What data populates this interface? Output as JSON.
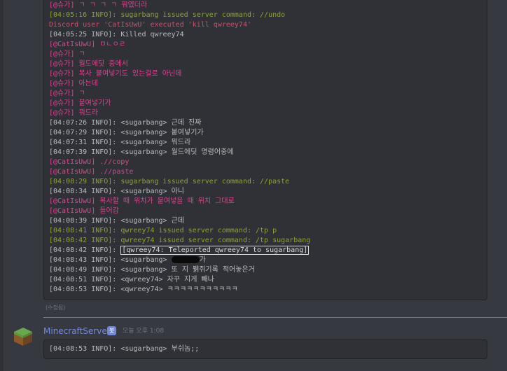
{
  "message1": {
    "lines": [
      {
        "text": "[@슈가] ㄱ ㄱ ㄱ ㄱ 뭐였더라",
        "color": "magenta"
      },
      {
        "text": "[04:05:16 INFO]: sugarbang issued server command: //undo",
        "color": "green"
      },
      {
        "text": "Discord user 'CatIsUwU' executed 'kill qwreey74'",
        "color": "pink"
      },
      {
        "text": "[04:05:25 INFO]: Killed qwreey74",
        "color": "plain"
      },
      {
        "text": "[@CatIsUwU] ㅁㄴㅇㄹ",
        "color": "magenta"
      },
      {
        "text": "[@슈가] ㄱ",
        "color": "magenta"
      },
      {
        "text": "[@슈가] 월드에딧 중에서",
        "color": "magenta"
      },
      {
        "text": "[@슈가] 복사 붙여넣기도 있는걸로 아닌데",
        "color": "magenta"
      },
      {
        "text": "[@슈가] 아는데",
        "color": "magenta"
      },
      {
        "text": "[@슈가] ㄱ",
        "color": "magenta"
      },
      {
        "text": "[@슈가] 붙여넣기가",
        "color": "magenta"
      },
      {
        "text": "[@슈가] 뭐드라",
        "color": "magenta"
      },
      {
        "text": "[04:07:26 INFO]: <sugarbang> 근데 진짜",
        "color": "plain"
      },
      {
        "text": "[04:07:29 INFO]: <sugarbang> 붙여넣기가",
        "color": "plain"
      },
      {
        "text": "[04:07:31 INFO]: <sugarbang> 뭐드라",
        "color": "plain"
      },
      {
        "text": "[04:07:39 INFO]: <sugarbang> 월드에딧 명령어중에",
        "color": "plain"
      },
      {
        "text": "[@CatIsUwU] .//copy",
        "color": "magenta"
      },
      {
        "text": "[@CatIsUwU] .//paste",
        "color": "magenta"
      },
      {
        "text": "[04:08:29 INFO]: sugarbang issued server command: //paste",
        "color": "green"
      },
      {
        "text": "[04:08:34 INFO]: <sugarbang> 아니",
        "color": "plain"
      },
      {
        "text": "[@CatIsUwU] 복사할 때 위치가 붙여넣을 때 위치 그대로",
        "color": "magenta"
      },
      {
        "text": "[@CatIsUwU] 들어감",
        "color": "magenta"
      },
      {
        "text": "[04:08:39 INFO]: <sugarbang> 근데",
        "color": "plain"
      },
      {
        "text": "[04:08:41 INFO]: qwreey74 issued server command: /tp p",
        "color": "green"
      },
      {
        "text": "[04:08:42 INFO]: qwreey74 issued server command: /tp sugarbang",
        "color": "green"
      },
      {
        "text": "[04:08:42 INFO]: ",
        "color": "plain",
        "highlight": "[qwreey74: Teleported qwreey74 to sugarbang]"
      },
      {
        "text": "[04:08:43 INFO]: <sugarbang> ",
        "color": "plain",
        "censored": true,
        "suffix": "가"
      },
      {
        "text": "[04:08:49 INFO]: <sugarbang> 또 지 뷁쥐기록 적어놓은거",
        "color": "plain"
      },
      {
        "text": "[04:08:51 INFO]: <qwreey74> 자꾸 지게 빼나",
        "color": "plain"
      },
      {
        "text": "[04:08:53 INFO]: <qwreey74> ㅋㅋㅋㅋㅋㅋㅋㅋㅋㅋㅋ",
        "color": "plain"
      }
    ],
    "edited_label": "(수정됨)"
  },
  "message2": {
    "author": "MinecraftServer",
    "bot_badge": "봇",
    "timestamp": "오늘 오후 1:08",
    "line": "[04:08:53 INFO]: <sugarbang> 부쉬놈;;"
  },
  "colors": {
    "background": "#36393f",
    "codeblock": "#2f3136",
    "green": "#8da621",
    "pink": "#e0466f",
    "magenta": "#d9458f",
    "author": "#7289da",
    "divider": "#f04747"
  }
}
